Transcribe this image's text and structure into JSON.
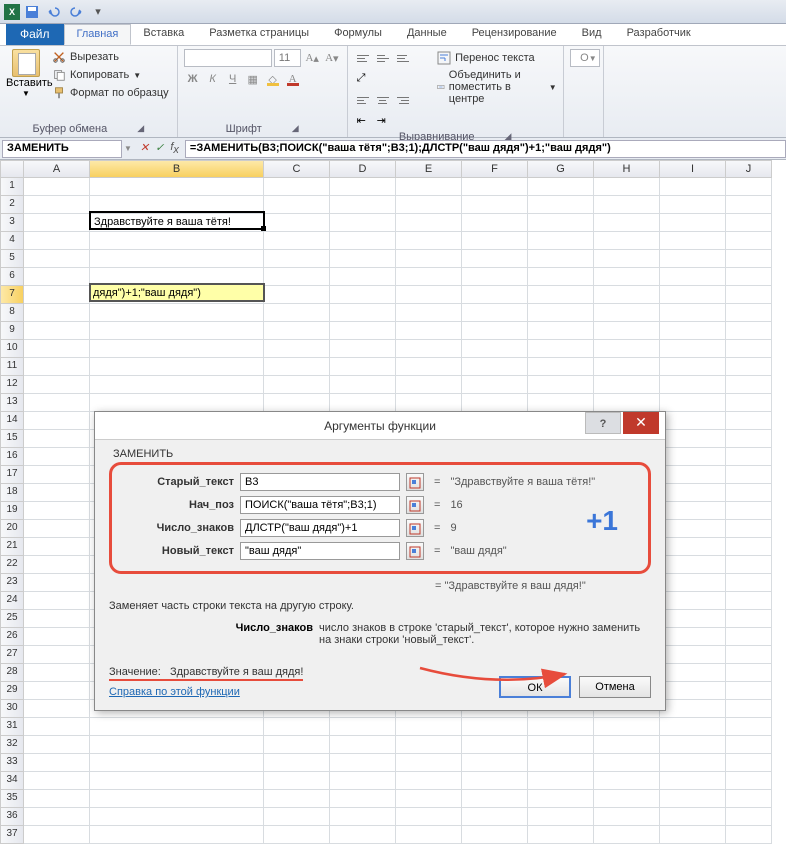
{
  "qat_tip": "Save Undo Redo",
  "tabs": {
    "file": "Файл",
    "home": "Главная",
    "insert": "Вставка",
    "layout": "Разметка страницы",
    "formulas": "Формулы",
    "data": "Данные",
    "review": "Рецензирование",
    "view": "Вид",
    "dev": "Разработчик"
  },
  "ribbon": {
    "paste": "Вставить",
    "cut": "Вырезать",
    "copy": "Копировать",
    "format": "Формат по образцу",
    "clipboard_label": "Буфер обмена",
    "font_label": "Шрифт",
    "align_label": "Выравнивание",
    "font_size": "11",
    "wrap": "Перенос текста",
    "merge": "Объединить и поместить в центре"
  },
  "namebox": "ЗАМЕНИТЬ",
  "formula": "=ЗАМЕНИТЬ(B3;ПОИСК(\"ваша тётя\";B3;1);ДЛСТР(\"ваш дядя\")+1;\"ваш дядя\")",
  "cells": {
    "b3": "Здравствуйте я ваша тётя!",
    "b7": "дядя\")+1;\"ваш дядя\")"
  },
  "cols": [
    "",
    "A",
    "B",
    "C",
    "D",
    "E",
    "F",
    "G",
    "H",
    "I",
    "J"
  ],
  "dialog": {
    "title": "Аргументы функции",
    "fn": "ЗАМЕНИТЬ",
    "args": [
      {
        "label": "Старый_текст",
        "value": "B3",
        "result": "\"Здравствуйте я ваша тётя!\""
      },
      {
        "label": "Нач_поз",
        "value": "ПОИСК(\"ваша тётя\";B3;1)",
        "result": "16"
      },
      {
        "label": "Число_знаков",
        "value": "ДЛСТР(\"ваш дядя\")+1",
        "result": "9"
      },
      {
        "label": "Новый_текст",
        "value": "\"ваш дядя\"",
        "result": "\"ваш дядя\""
      }
    ],
    "annot": "+1",
    "result_preview": "=   \"Здравствуйте я ваш дядя!\"",
    "desc1": "Заменяет часть строки текста на другую строку.",
    "desc2_label": "Число_знаков",
    "desc2_text": "число знаков в строке 'старый_текст', которое нужно заменить на знаки строки 'новый_текст'.",
    "value_label": "Значение:",
    "value": "Здравствуйте я ваш дядя!",
    "help": "Справка по этой функции",
    "ok": "ОК",
    "cancel": "Отмена"
  }
}
